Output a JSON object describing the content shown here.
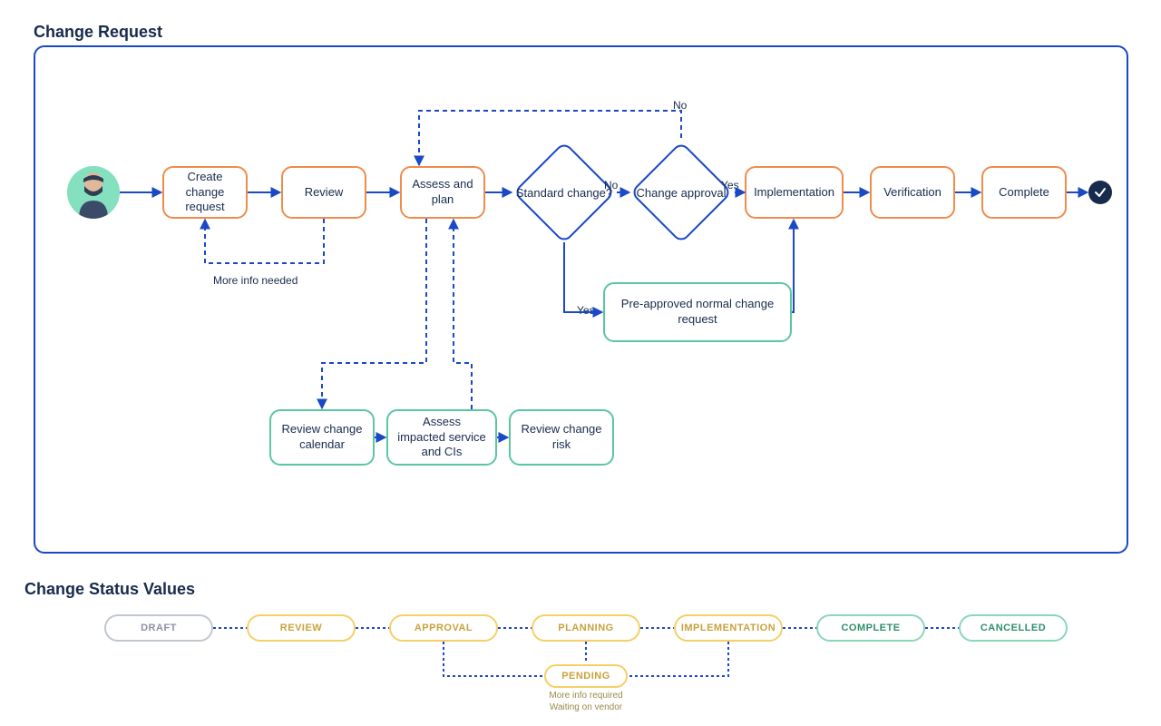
{
  "titles": {
    "change_request": "Change Request",
    "status_values": "Change Status Values"
  },
  "nodes": {
    "create": "Create change request",
    "review": "Review",
    "assess": "Assess and plan",
    "standard": "Standard change?",
    "approval": "Change approval",
    "implementation": "Implementation",
    "verification": "Verification",
    "complete": "Complete",
    "preapproved": "Pre-approved normal change request",
    "review_calendar": "Review change calendar",
    "assess_impacted": "Assess impacted service and CIs",
    "review_risk": "Review change risk"
  },
  "edge_labels": {
    "more_info": "More info needed",
    "no_top": "No",
    "no_decision": "No",
    "yes_decision": "Yes",
    "yes_approval": "Yes"
  },
  "statuses": {
    "draft": "DRAFT",
    "review": "REVIEW",
    "approval": "APPROVAL",
    "planning": "PLANNING",
    "implementation": "IMPLEMENTATION",
    "complete": "COMPLETE",
    "cancelled": "CANCELLED",
    "pending": "PENDING"
  },
  "pending_sub": {
    "line1": "More info required",
    "line2": "Waiting on vendor"
  }
}
